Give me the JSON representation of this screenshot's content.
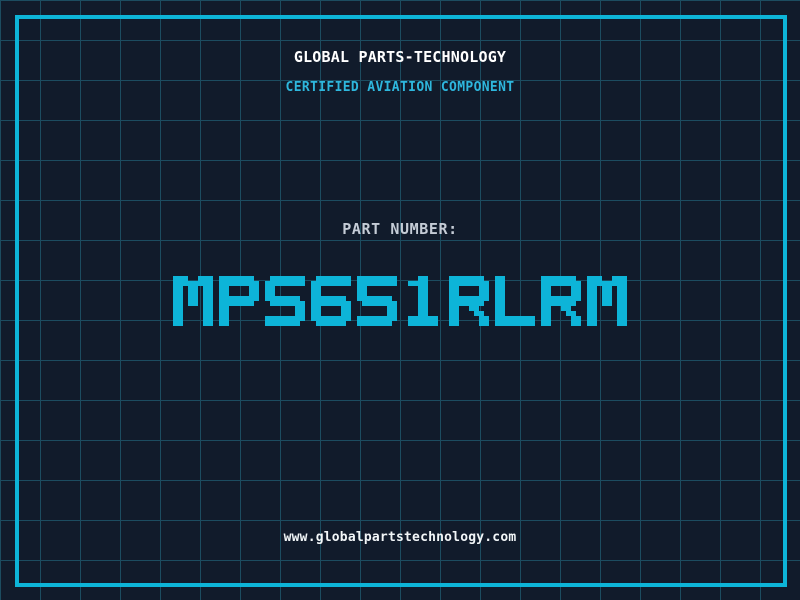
{
  "header": {
    "title": "GLOBAL PARTS-TECHNOLOGY",
    "subtitle": "CERTIFIED AVIATION COMPONENT"
  },
  "part": {
    "label": "PART NUMBER:",
    "number": "MPS651RLRM"
  },
  "footer": {
    "url": "www.globalpartstechnology.com"
  },
  "colors": {
    "background": "#111b2b",
    "grid_line": "#1c4c60",
    "frame": "#0db4d8",
    "accent": "#0db4d8",
    "subtitle": "#2eb7dd",
    "label": "#c5ccd6",
    "title": "#ffffff",
    "url": "#f2f6f8"
  }
}
